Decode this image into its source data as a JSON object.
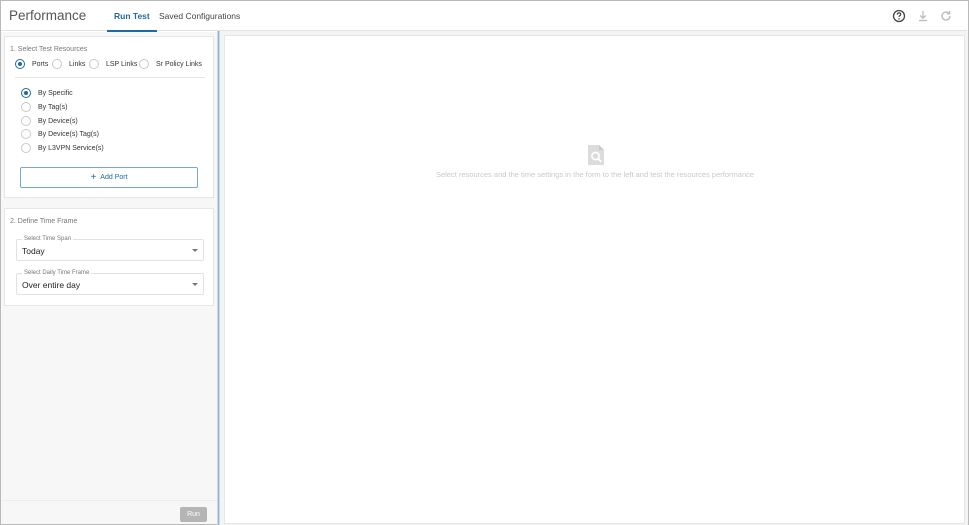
{
  "header": {
    "title": "Performance",
    "tabs": [
      {
        "label": "Run Test",
        "active": true
      },
      {
        "label": "Saved Configurations",
        "active": false
      }
    ],
    "icons": [
      "help-icon",
      "download-icon",
      "refresh-icon"
    ]
  },
  "resources": {
    "section_title": "1. Select Test Resources",
    "types": [
      "Ports",
      "Links",
      "LSP Links",
      "Sr Policy Links"
    ],
    "selected_type": "Ports",
    "methods": [
      "By Specific",
      "By Tag(s)",
      "By Device(s)",
      "By Device(s) Tag(s)",
      "By L3VPN Service(s)"
    ],
    "selected_method": "By Specific",
    "add_button_label": "Add Port"
  },
  "time_frame": {
    "section_title": "2. Define Time Frame",
    "time_span_label": "Select Time Span",
    "time_span_value": "Today",
    "daily_label": "Select Daily Time Frame",
    "daily_value": "Over entire day"
  },
  "footer": {
    "run_label": "Run"
  },
  "empty_state": {
    "message": "Select resources and the time settings in the form to the left and test the resources performance",
    "icon": "search-document-icon"
  },
  "colors": {
    "accent": "#1f6aa5",
    "splitter": "#c7d8ea",
    "disabled_button": "#b5b5b5"
  }
}
